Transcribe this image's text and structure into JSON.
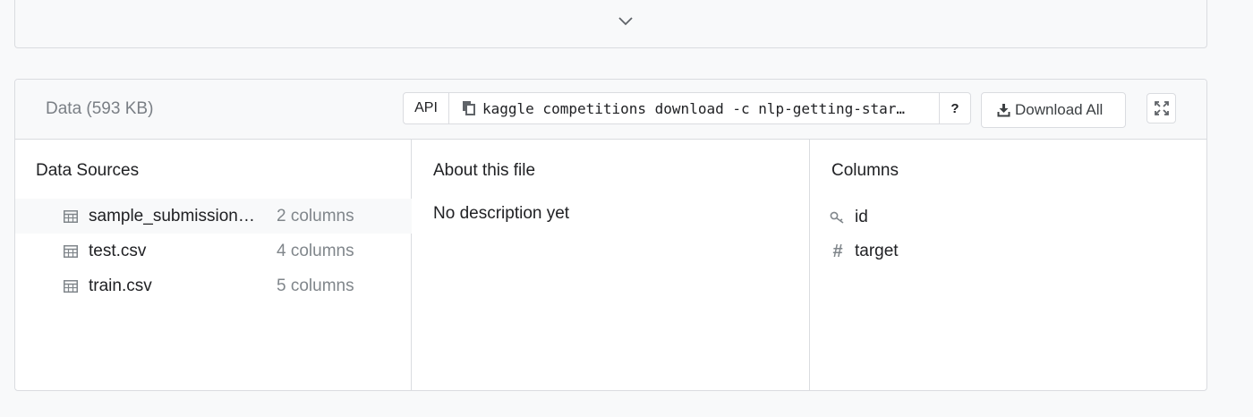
{
  "top_card": {
    "icon": "chevron-down-icon"
  },
  "data_panel": {
    "title": "Data (593 KB)",
    "api": {
      "label": "API",
      "command": "kaggle competitions download -c nlp-getting-star…",
      "help_label": "?"
    },
    "download_label": "Download All",
    "expand_icon": "expand-icon"
  },
  "data_sources": {
    "heading": "Data Sources",
    "items": [
      {
        "name": "sample_submission…",
        "columns": "2 columns",
        "icon": "table-icon"
      },
      {
        "name": "test.csv",
        "columns": "4 columns",
        "icon": "table-icon"
      },
      {
        "name": "train.csv",
        "columns": "5 columns",
        "icon": "table-icon"
      }
    ]
  },
  "about": {
    "heading": "About this file",
    "description": "No description yet"
  },
  "columns": {
    "heading": "Columns",
    "items": [
      {
        "name": "id",
        "icon": "key-icon"
      },
      {
        "name": "target",
        "icon": "hash-icon"
      }
    ]
  },
  "colors": {
    "border": "#dadce0",
    "muted": "#80868b",
    "text": "#202124",
    "header_bg": "#f8f9fa"
  }
}
